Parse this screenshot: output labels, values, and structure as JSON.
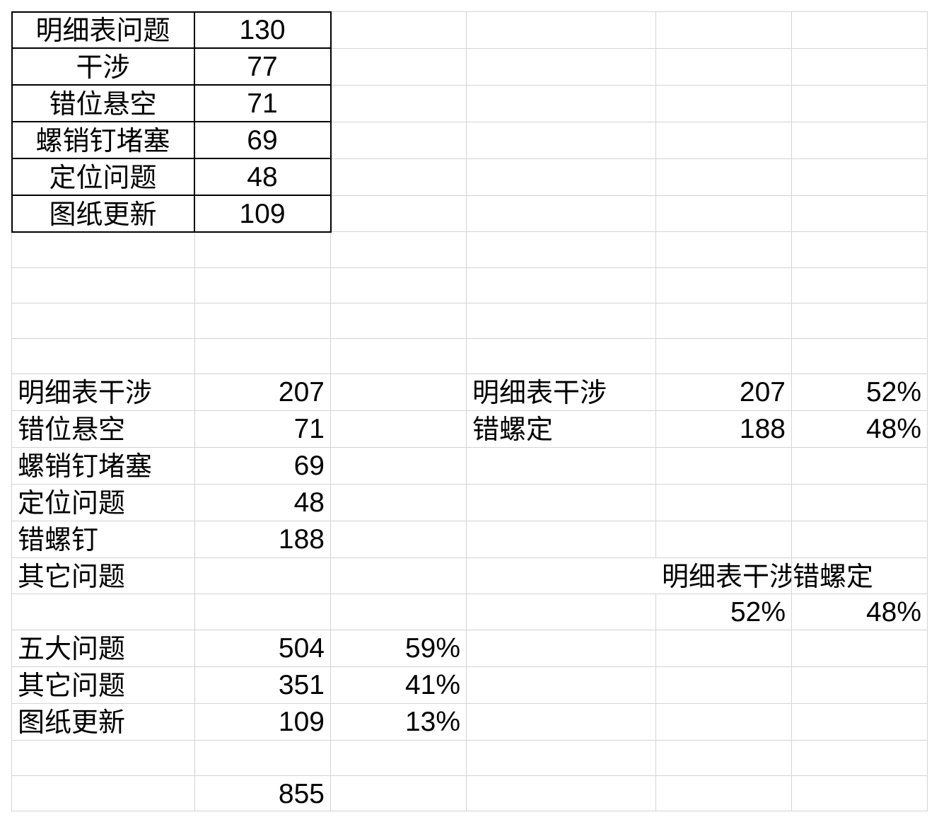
{
  "top_table": [
    {
      "label": "明细表问题",
      "value": "130"
    },
    {
      "label": "干涉",
      "value": "77"
    },
    {
      "label": "错位悬空",
      "value": "71"
    },
    {
      "label": "螺销钉堵塞",
      "value": "69"
    },
    {
      "label": "定位问题",
      "value": "48"
    },
    {
      "label": "图纸更新",
      "value": "109"
    }
  ],
  "summary": [
    {
      "label": "明细表干涉",
      "value": "207",
      "pct": ""
    },
    {
      "label": "错位悬空",
      "value": "71",
      "pct": ""
    },
    {
      "label": "螺销钉堵塞",
      "value": "69",
      "pct": ""
    },
    {
      "label": "定位问题",
      "value": "48",
      "pct": ""
    },
    {
      "label": "错螺钉",
      "value": "188",
      "pct": ""
    },
    {
      "label": "其它问题",
      "value": "",
      "pct": ""
    },
    {
      "label": "",
      "value": "",
      "pct": ""
    },
    {
      "label": "五大问题",
      "value": "504",
      "pct": "59%"
    },
    {
      "label": "其它问题",
      "value": "351",
      "pct": "41%"
    },
    {
      "label": "图纸更新",
      "value": "109",
      "pct": "13%"
    },
    {
      "label": "",
      "value": "",
      "pct": ""
    },
    {
      "label": "",
      "value": "855",
      "pct": ""
    }
  ],
  "ratio_table": [
    {
      "label": "明细表干涉",
      "value": "207",
      "pct": "52%"
    },
    {
      "label": "错螺定",
      "value": "188",
      "pct": "48%"
    }
  ],
  "horizontal_labels": [
    "明细表干涉",
    "错螺定"
  ],
  "horizontal_pcts": [
    "52%",
    "48%"
  ]
}
